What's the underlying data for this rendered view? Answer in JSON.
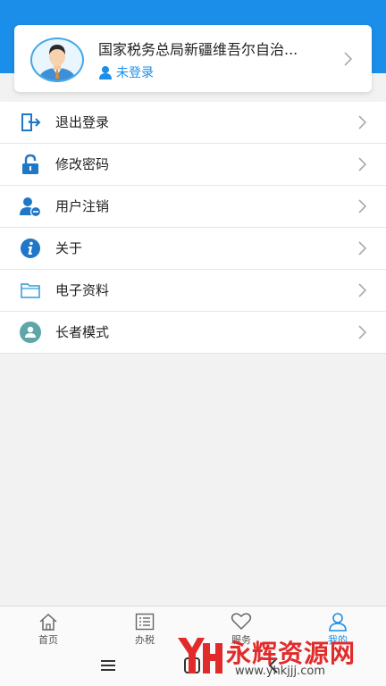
{
  "profile": {
    "org_name": "国家税务总局新疆维吾尔自治...",
    "login_status": "未登录"
  },
  "menu": [
    {
      "label": "退出登录",
      "icon": "logout-door-icon"
    },
    {
      "label": "修改密码",
      "icon": "lock-icon"
    },
    {
      "label": "用户注销",
      "icon": "user-remove-icon"
    },
    {
      "label": "关于",
      "icon": "info-icon"
    },
    {
      "label": "电子资料",
      "icon": "folder-icon"
    },
    {
      "label": "长者模式",
      "icon": "elder-mode-icon"
    }
  ],
  "tabs": [
    {
      "label": "首页",
      "icon": "home-icon"
    },
    {
      "label": "办税",
      "icon": "list-icon"
    },
    {
      "label": "服务",
      "icon": "heart-icon"
    },
    {
      "label": "我的",
      "icon": "person-icon",
      "active": true
    }
  ],
  "watermark": {
    "text": "永辉资源网",
    "url": "www.yhkjjj.com"
  },
  "colors": {
    "primary": "#1a8ee8",
    "watermark": "#e02b2b"
  }
}
